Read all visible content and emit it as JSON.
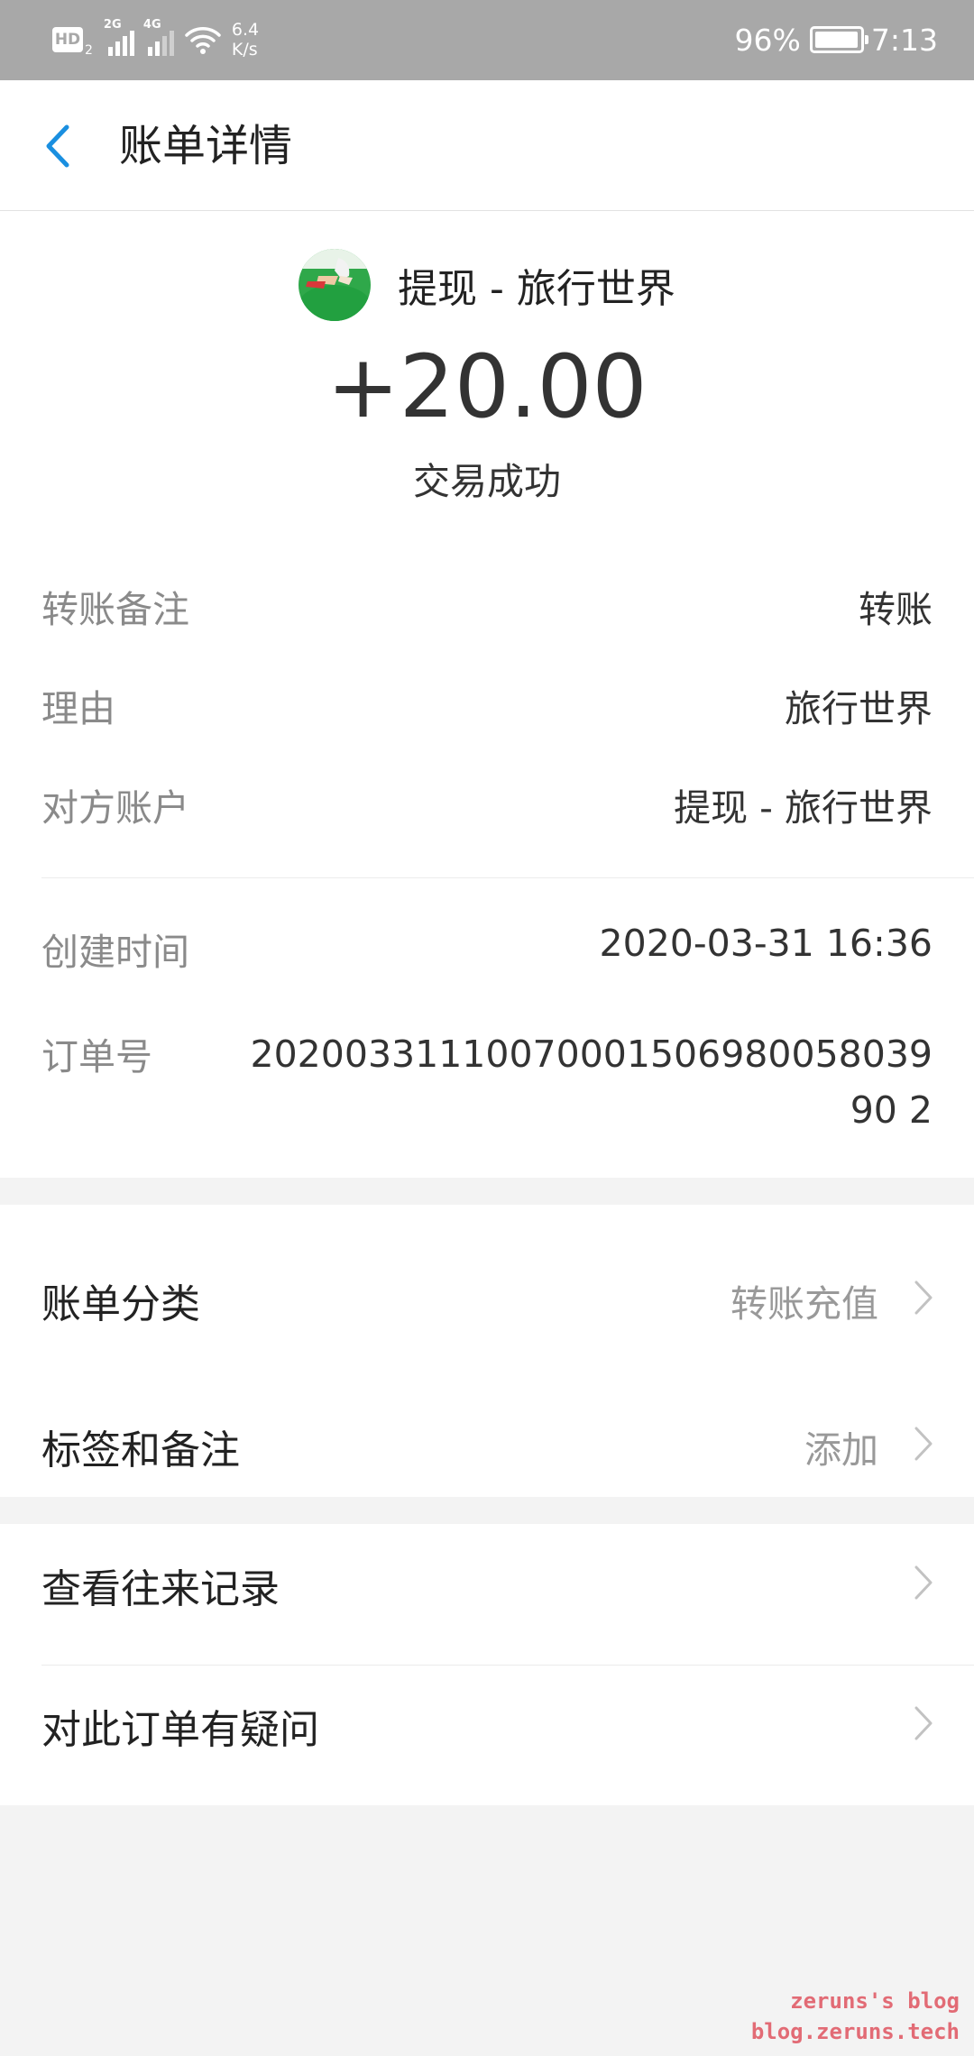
{
  "status_bar": {
    "hd": "HD",
    "hd_sub": "2",
    "net1": "2G",
    "net2": "4G",
    "speed_value": "6.4",
    "speed_unit": "K/s",
    "battery_percent": "96%",
    "time": "7:13"
  },
  "nav": {
    "title": "账单详情"
  },
  "transaction": {
    "payee": "提现 - 旅行世界",
    "amount": "+20.00",
    "status": "交易成功"
  },
  "details": {
    "remark_label": "转账备注",
    "remark_value": "转账",
    "reason_label": "理由",
    "reason_value": "旅行世界",
    "account_label": "对方账户",
    "account_value": "提现 - 旅行世界",
    "created_label": "创建时间",
    "created_value": "2020-03-31 16:36",
    "order_label": "订单号",
    "order_value": "2020033111007000150698005803990 2"
  },
  "sections": {
    "category_label": "账单分类",
    "category_value": "转账充值",
    "tags_label": "标签和备注",
    "tags_value": "添加",
    "history_label": "查看往来记录",
    "question_label": "对此订单有疑问"
  },
  "watermark": {
    "line1": "zeruns's blog",
    "line2": "blog.zeruns.tech"
  },
  "colors": {
    "status_bar_bg": "#a8a8a8",
    "accent_blue": "#1a8fe0",
    "background": "#f3f3f3",
    "watermark": "#e26b75"
  }
}
